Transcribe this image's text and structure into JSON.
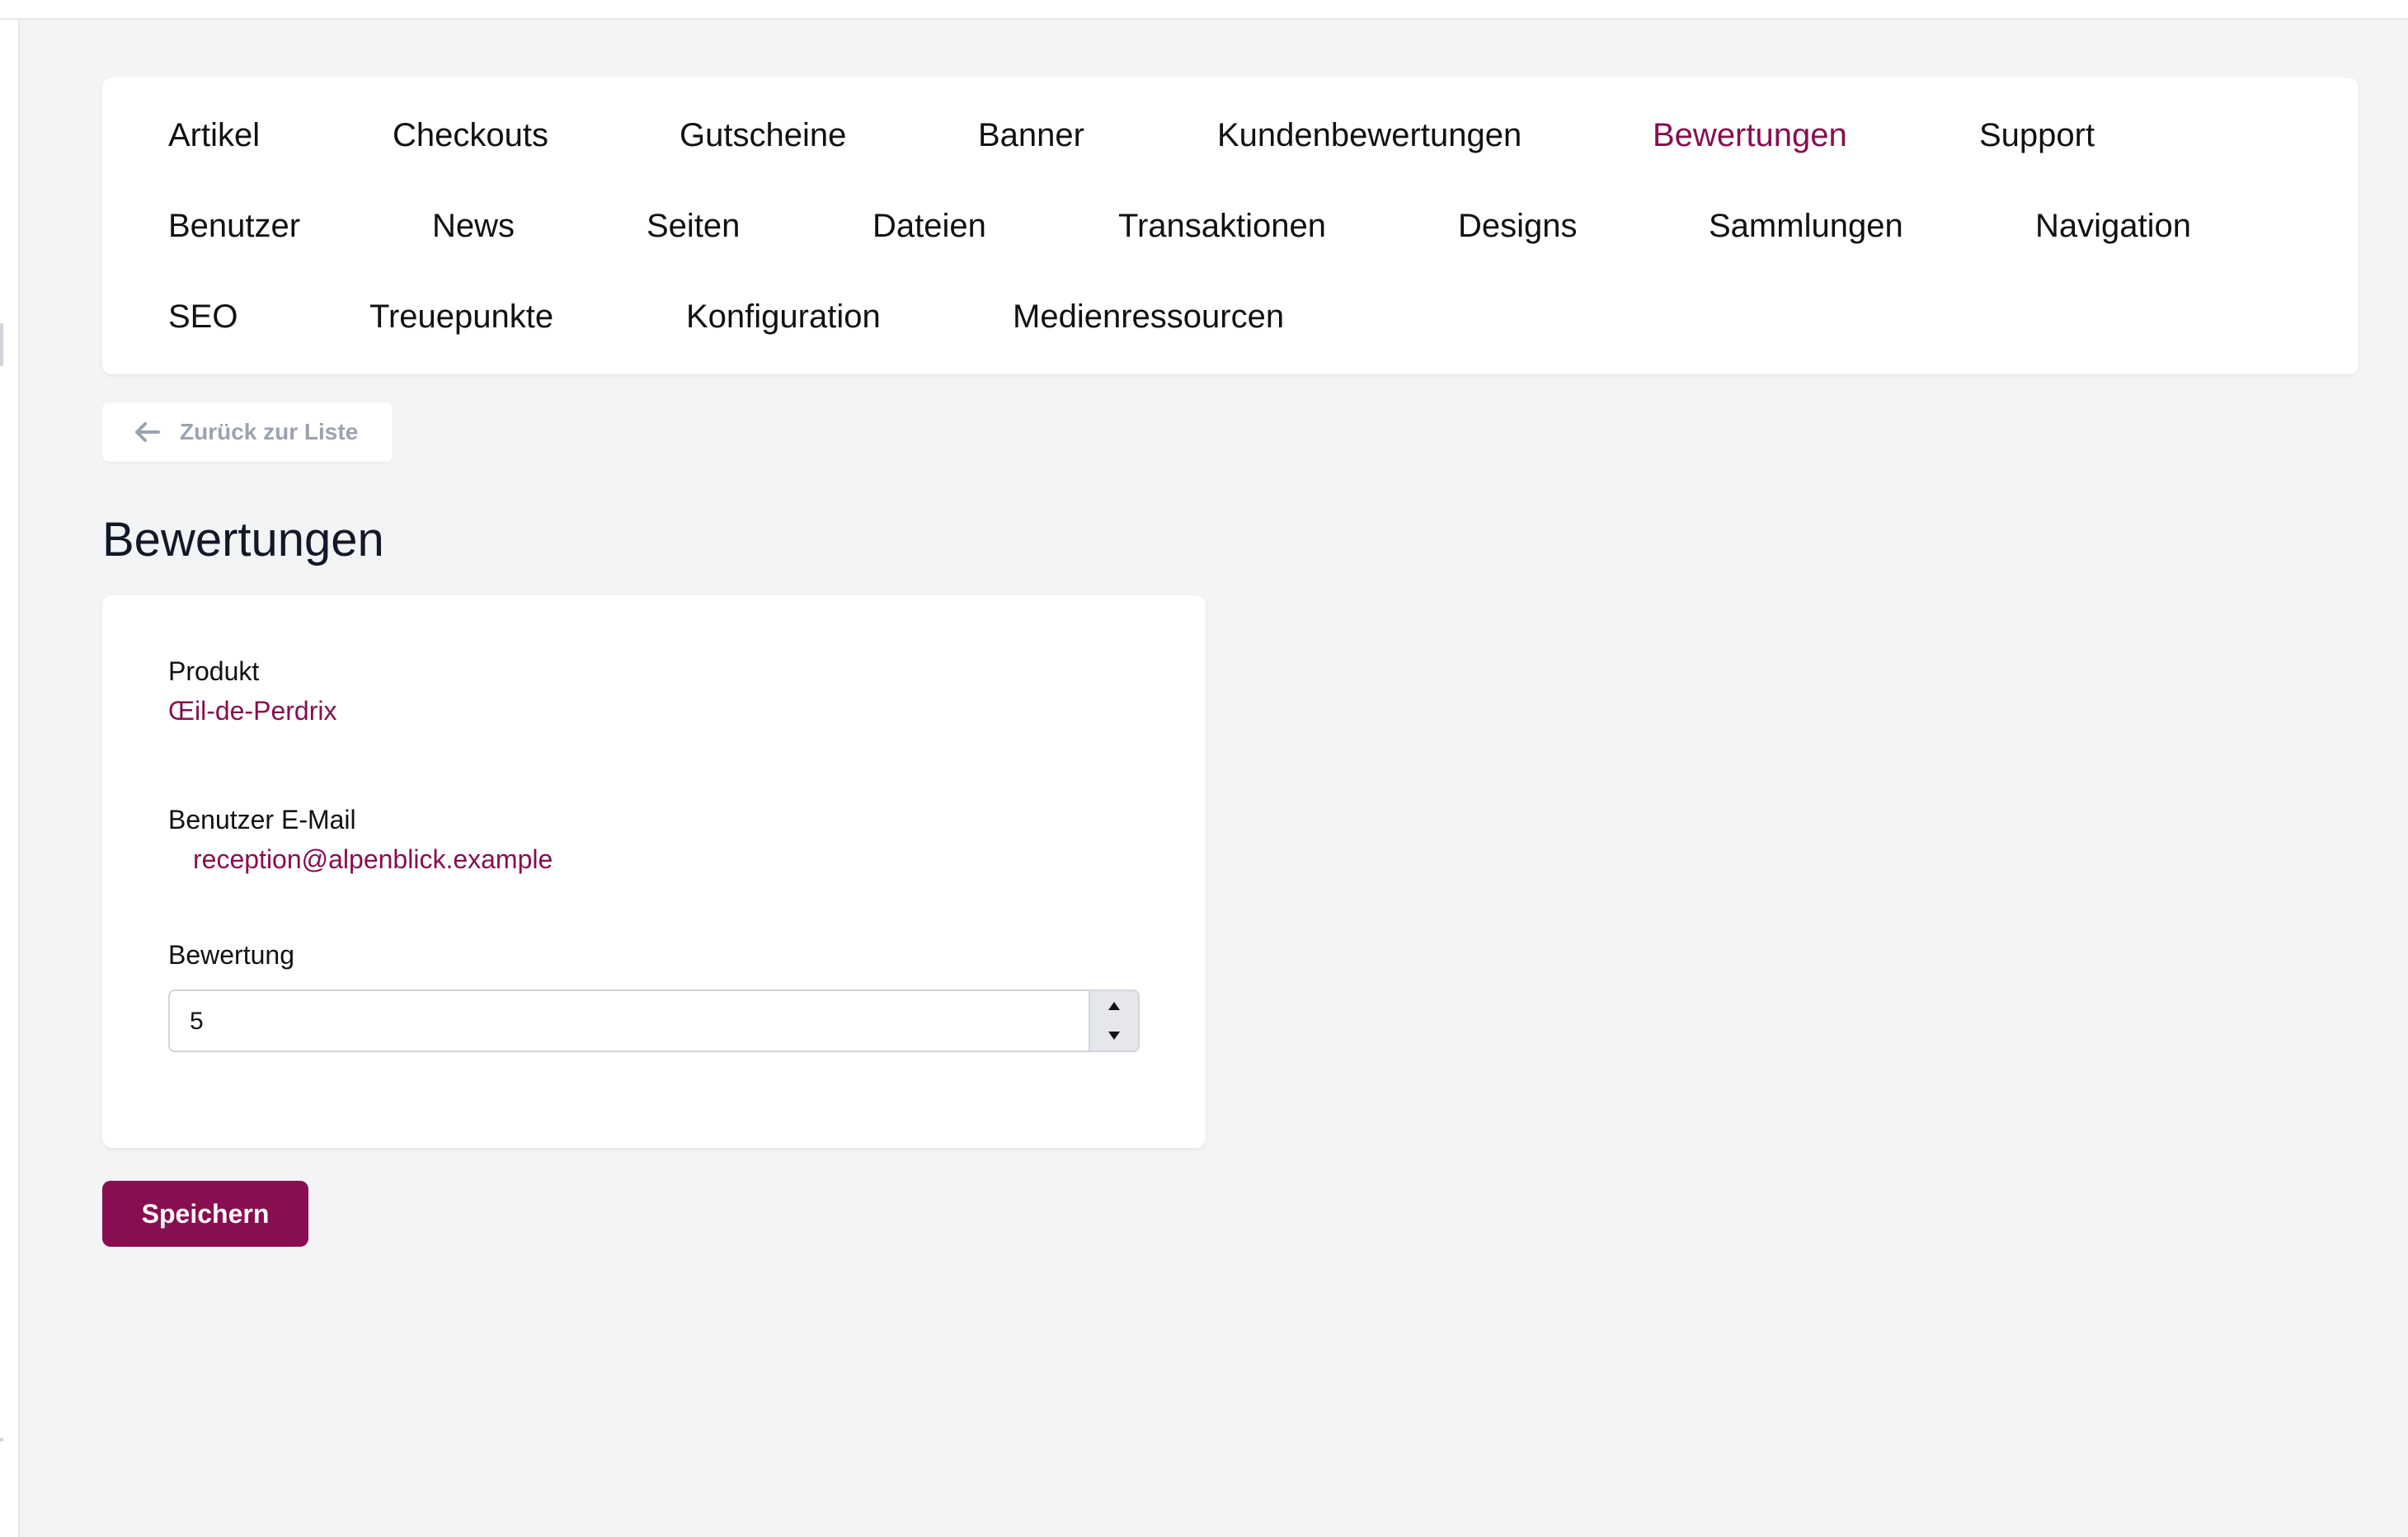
{
  "nav": {
    "items": [
      {
        "label": "Artikel"
      },
      {
        "label": "Checkouts"
      },
      {
        "label": "Gutscheine"
      },
      {
        "label": "Banner"
      },
      {
        "label": "Kundenbewertungen"
      },
      {
        "label": "Bewertungen",
        "active": true
      },
      {
        "label": "Support"
      },
      {
        "label": "Benutzer"
      },
      {
        "label": "News"
      },
      {
        "label": "Seiten"
      },
      {
        "label": "Dateien"
      },
      {
        "label": "Transaktionen"
      },
      {
        "label": "Designs"
      },
      {
        "label": "Sammlungen"
      },
      {
        "label": "Navigation"
      },
      {
        "label": "SEO"
      },
      {
        "label": "Treuepunkte"
      },
      {
        "label": "Konfiguration"
      },
      {
        "label": "Medienressourcen"
      }
    ]
  },
  "back_button": {
    "label": "Zurück zur Liste",
    "icon": "arrow-left-icon"
  },
  "page": {
    "title": "Bewertungen"
  },
  "form": {
    "product": {
      "label": "Produkt",
      "value": "Œil-de-Perdrix"
    },
    "user_email": {
      "label": "Benutzer E-Mail",
      "value": "reception@alpenblick.example"
    },
    "rating": {
      "label": "Bewertung",
      "value": "5"
    }
  },
  "save_button": {
    "label": "Speichern"
  },
  "colors": {
    "accent": "#880e4f",
    "background": "#f3f4f6",
    "card": "#ffffff",
    "muted_text": "#9ca3af"
  }
}
